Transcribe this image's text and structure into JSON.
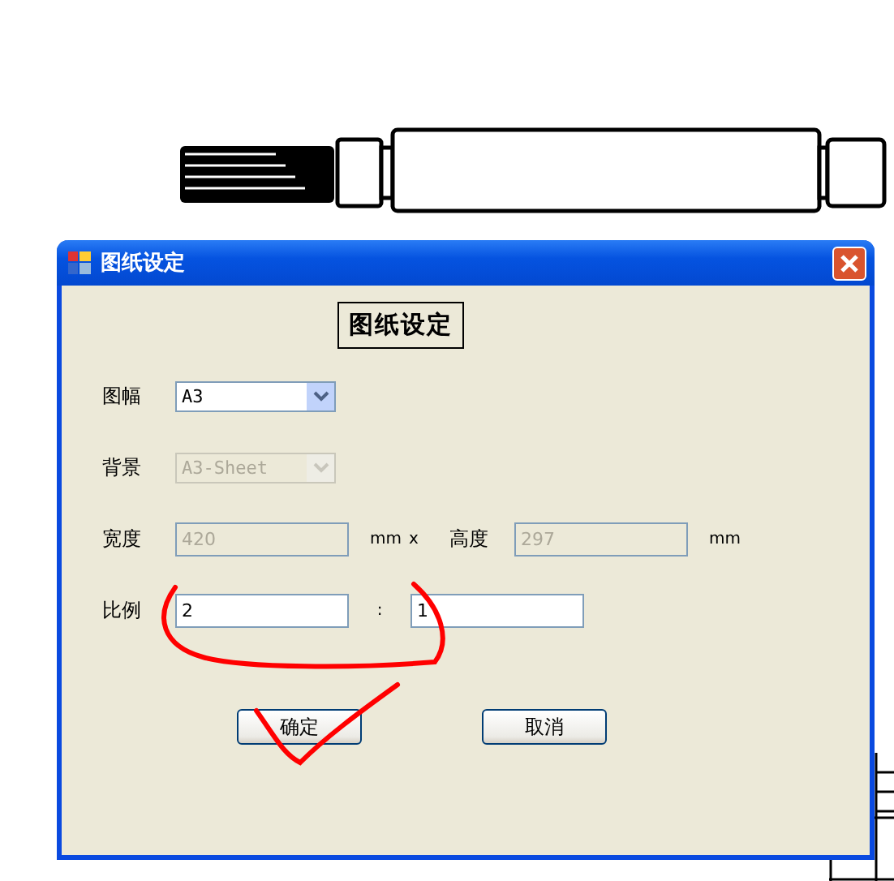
{
  "window": {
    "title": "图纸设定"
  },
  "heading": "图纸设定",
  "fields": [
    {
      "kind": "combo",
      "label": "图幅",
      "value": "A3",
      "disabled": false
    },
    {
      "kind": "combo",
      "label": "背景",
      "value": "A3-Sheet",
      "disabled": true
    },
    {
      "kind": "size",
      "label": "宽度",
      "value": "420",
      "unit": "mm",
      "separator": "x",
      "label2": "高度",
      "value2": "297",
      "unit2": "mm",
      "disabled": true
    },
    {
      "kind": "ratio",
      "label": "比例",
      "value": "2",
      "separator": ":",
      "value2": "1",
      "disabled": false
    }
  ],
  "buttons": [
    "确定",
    "取消"
  ]
}
